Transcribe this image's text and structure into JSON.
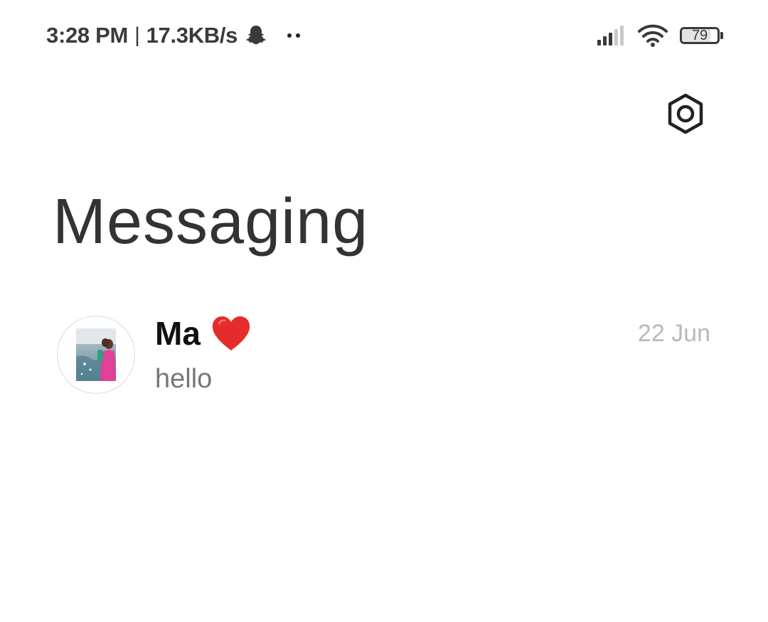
{
  "status_bar": {
    "time": "3:28 PM",
    "separator": "|",
    "network_speed": "17.3KB/s",
    "left_icons": [
      "snapchat-icon",
      "more-notifications-icon"
    ],
    "right_icons": [
      "signal-icon",
      "wifi-icon",
      "battery-icon"
    ],
    "battery_level": "79",
    "battery_fraction": 0.79
  },
  "header": {
    "settings_icon": "settings-hexagon-icon",
    "title": "Messaging"
  },
  "conversations": [
    {
      "name": "Ma",
      "name_emoji": "heart-icon",
      "preview": "hello",
      "date": "22 Jun",
      "avatar": "avatar-photo"
    }
  ],
  "colors": {
    "title_text": "#333333",
    "name_text": "#111111",
    "preview_text": "#777777",
    "date_text": "#b9b9b9",
    "heart": "#e52b2b"
  }
}
